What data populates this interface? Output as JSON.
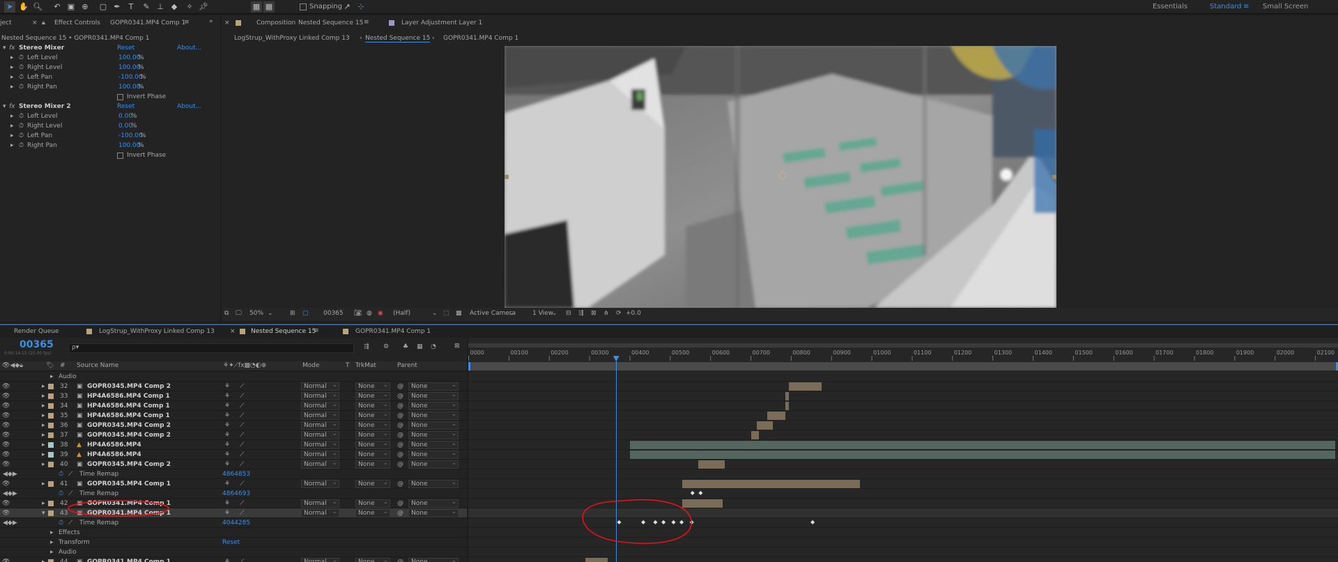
{
  "toolbar": {
    "snapping_label": "Snapping",
    "workspaces": [
      "Essentials",
      "Standard",
      "Small Screen"
    ],
    "active_workspace": "Standard"
  },
  "effect_controls": {
    "tab_prefix": "ject",
    "tab_label": "Effect Controls",
    "tab_target": "GOPR0341.MP4 Comp 1",
    "breadcrumb": "Nested Sequence 15 • GOPR0341.MP4 Comp 1",
    "effects": [
      {
        "name": "Stereo Mixer",
        "reset": "Reset",
        "about": "About...",
        "params": [
          {
            "label": "Left Level",
            "value": "100.00",
            "unit": "%"
          },
          {
            "label": "Right Level",
            "value": "100.00",
            "unit": "%"
          },
          {
            "label": "Left Pan",
            "value": "-100.00",
            "unit": "%"
          },
          {
            "label": "Right Pan",
            "value": "100.00",
            "unit": "%"
          }
        ],
        "checkbox": "Invert Phase"
      },
      {
        "name": "Stereo Mixer 2",
        "reset": "Reset",
        "about": "About...",
        "params": [
          {
            "label": "Left Level",
            "value": "0.00",
            "unit": "%"
          },
          {
            "label": "Right Level",
            "value": "0.00",
            "unit": "%"
          },
          {
            "label": "Left Pan",
            "value": "-100.00",
            "unit": "%"
          },
          {
            "label": "Right Pan",
            "value": "100.00",
            "unit": "%"
          }
        ],
        "checkbox": "Invert Phase"
      }
    ]
  },
  "composition": {
    "tab_label": "Composition",
    "tab_target": "Nested Sequence 15",
    "layer_tab": "Layer  Adjustment Layer 1",
    "breadcrumbs": [
      "LogStrup_WithProxy Linked Comp 13",
      "Nested Sequence 15",
      "GOPR0341.MP4 Comp 1"
    ],
    "active_breadcrumb": "Nested Sequence 15",
    "viewer_bar": {
      "zoom": "50%",
      "timecode": "00365",
      "resolution": "(Half)",
      "camera": "Active Camera",
      "views": "1 View",
      "exposure": "+0.0"
    }
  },
  "timeline": {
    "tabs": [
      "Render Queue",
      "LogStrup_WithProxy Linked Comp 13",
      "Nested Sequence 15",
      "GOPR0341.MP4 Comp 1"
    ],
    "active_tab": "Nested Sequence 15",
    "current_time": "00365",
    "current_time_sub": "0:00:14:15 (25.00 fps)",
    "search_placeholder": "ρ▾",
    "columns": {
      "num": "#",
      "source": "Source Name",
      "mode": "Mode",
      "t": "T",
      "trkmat": "TrkMat",
      "parent": "Parent"
    },
    "ruler": [
      "0000",
      "00100",
      "00200",
      "00300",
      "00400",
      "00500",
      "00600",
      "00700",
      "00800",
      "00900",
      "01000",
      "01100",
      "01200",
      "01300",
      "01400",
      "01500",
      "01600",
      "01700",
      "01800",
      "01900",
      "02000",
      "02100"
    ],
    "current_frame": 365,
    "rows": [
      {
        "kind": "prop",
        "label": "Audio"
      },
      {
        "kind": "layer",
        "num": "32",
        "name": "GOPR0345.MP4 Comp 2",
        "mode": "Normal",
        "trkmat": "None",
        "parent": "None",
        "color": "#b9a27d",
        "bar": [
          795,
          875
        ],
        "barColor": "#7a6c58"
      },
      {
        "kind": "layer",
        "num": "33",
        "name": "HP4A6586.MP4 Comp 1",
        "mode": "Normal",
        "trkmat": "None",
        "parent": "None",
        "color": "#b9a27d",
        "bar": [
          785,
          795
        ],
        "barColor": "#7a6c58"
      },
      {
        "kind": "layer",
        "num": "34",
        "name": "HP4A6586.MP4 Comp 1",
        "mode": "Normal",
        "trkmat": "None",
        "parent": "None",
        "color": "#b9a27d",
        "bar": [
          785,
          795
        ],
        "barColor": "#7a6c58"
      },
      {
        "kind": "layer",
        "num": "35",
        "name": "HP4A6586.MP4 Comp 1",
        "mode": "Normal",
        "trkmat": "None",
        "parent": "None",
        "color": "#b9a27d",
        "bar": [
          740,
          785
        ],
        "barColor": "#7a6c58"
      },
      {
        "kind": "layer",
        "num": "36",
        "name": "GOPR0345.MP4 Comp 2",
        "mode": "Normal",
        "trkmat": "None",
        "parent": "None",
        "color": "#b9a27d",
        "bar": [
          715,
          755
        ],
        "barColor": "#7a6c58"
      },
      {
        "kind": "layer",
        "num": "37",
        "name": "GOPR0345.MP4 Comp 2",
        "mode": "Normal",
        "trkmat": "None",
        "parent": "None",
        "color": "#b9a27d",
        "bar": [
          700,
          720
        ],
        "barColor": "#7a6c58"
      },
      {
        "kind": "layer",
        "num": "38",
        "name": "HP4A6586.MP4",
        "mode": "Normal",
        "trkmat": "None",
        "parent": "None",
        "color": "#a7c7c7",
        "bar": [
          400,
          2150
        ],
        "barColor": "#55655f"
      },
      {
        "kind": "layer",
        "num": "39",
        "name": "HP4A6586.MP4",
        "mode": "Normal",
        "trkmat": "None",
        "parent": "None",
        "color": "#a7c7c7",
        "bar": [
          400,
          2150
        ],
        "barColor": "#55655f"
      },
      {
        "kind": "layer",
        "num": "40",
        "name": "GOPR0345.MP4 Comp 2",
        "mode": "Normal",
        "trkmat": "None",
        "parent": "None",
        "color": "#b9a27d",
        "bar": [
          570,
          635
        ],
        "barColor": "#7a6c58"
      },
      {
        "kind": "prop",
        "label": "Time Remap",
        "value": "4864853"
      },
      {
        "kind": "layer",
        "num": "41",
        "name": "GOPR0345.MP4 Comp 1",
        "mode": "Normal",
        "trkmat": "None",
        "parent": "None",
        "color": "#b9a27d",
        "bar": [
          530,
          970
        ],
        "barColor": "#7a6c58"
      },
      {
        "kind": "prop",
        "label": "Time Remap",
        "value": "4864693"
      },
      {
        "kind": "layer",
        "num": "42",
        "name": "GOPR0341.MP4 Comp 1",
        "mode": "Normal",
        "trkmat": "None",
        "parent": "None",
        "color": "#b9a27d",
        "bar": [
          530,
          630
        ],
        "barColor": "#7a6c58"
      },
      {
        "kind": "layer",
        "num": "43",
        "name": "GOPR0341.MP4 Comp 1",
        "mode": "Normal",
        "trkmat": "None",
        "parent": "None",
        "color": "#b9a27d",
        "bar": [
          350,
          530
        ],
        "barColor": "#c9b08a",
        "selected": true
      },
      {
        "kind": "prop",
        "label": "Time Remap",
        "value": "4044285"
      },
      {
        "kind": "prop",
        "label": "Effects"
      },
      {
        "kind": "prop",
        "label": "Transform",
        "value": "Reset"
      },
      {
        "kind": "prop",
        "label": "Audio"
      },
      {
        "kind": "layer",
        "num": "44",
        "name": "GOPR0341.MP4 Comp 1",
        "mode": "Normal",
        "trkmat": "None",
        "parent": "None",
        "color": "#b9a27d",
        "bar": [
          290,
          345
        ],
        "barColor": "#7a6c58"
      }
    ],
    "keyframes": [
      {
        "row": 12,
        "frames": [
          555,
          575
        ]
      },
      {
        "row": 15,
        "frames": [
          373,
          433,
          463,
          483,
          508,
          528,
          553,
          853
        ]
      }
    ]
  },
  "colors": {
    "accent": "#3d8ee6",
    "annotation": "#e8101a"
  }
}
